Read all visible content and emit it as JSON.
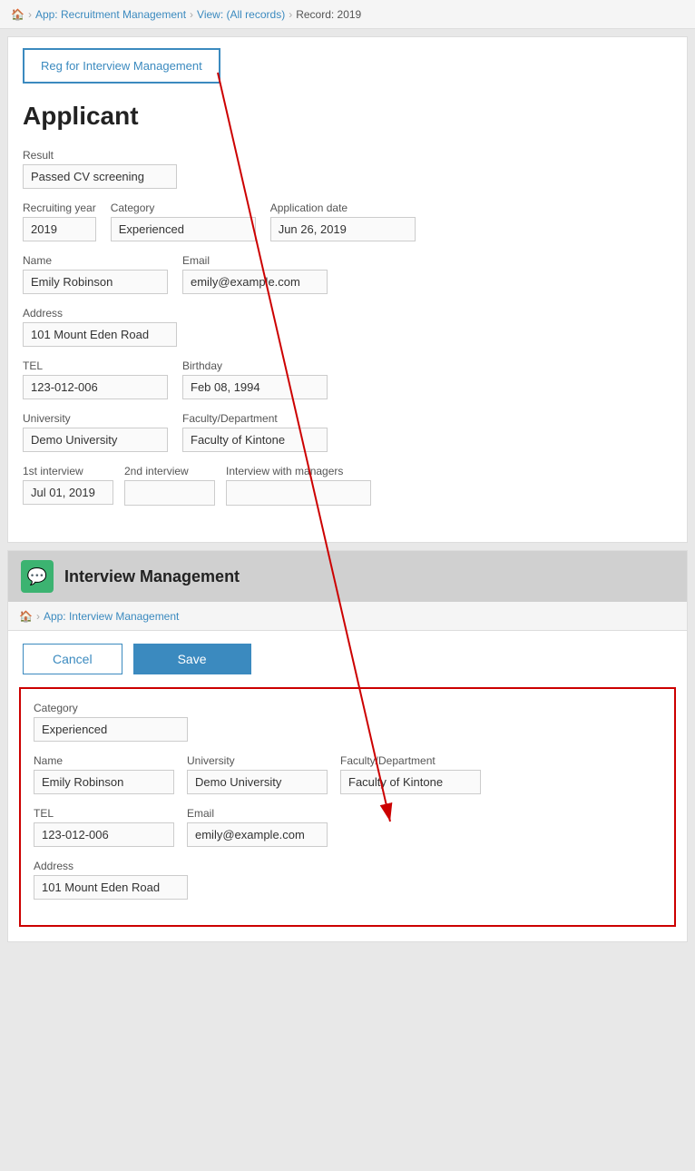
{
  "breadcrumb": {
    "home_icon": "🏠",
    "app_label": "App: Recruitment Management",
    "view_label": "View: (All records)",
    "record_label": "Record: 2019"
  },
  "top_button": {
    "label": "Reg for Interview Management"
  },
  "applicant": {
    "title": "Applicant",
    "fields": {
      "result_label": "Result",
      "result_value": "Passed CV screening",
      "recruiting_year_label": "Recruiting year",
      "recruiting_year_value": "2019",
      "category_label": "Category",
      "category_value": "Experienced",
      "application_date_label": "Application date",
      "application_date_value": "Jun 26, 2019",
      "name_label": "Name",
      "name_value": "Emily Robinson",
      "email_label": "Email",
      "email_value": "emily@example.com",
      "address_label": "Address",
      "address_value": "101 Mount Eden Road",
      "tel_label": "TEL",
      "tel_value": "123-012-006",
      "birthday_label": "Birthday",
      "birthday_value": "Feb 08, 1994",
      "university_label": "University",
      "university_value": "Demo University",
      "faculty_label": "Faculty/Department",
      "faculty_value": "Faculty of Kintone",
      "interview1_label": "1st interview",
      "interview1_value": "Jul 01, 2019",
      "interview2_label": "2nd interview",
      "interview2_value": "",
      "interview_managers_label": "Interview with managers",
      "interview_managers_value": ""
    }
  },
  "interview_management": {
    "header_title": "Interview Management",
    "header_icon": "💬",
    "breadcrumb": {
      "home_icon": "🏠",
      "app_label": "App: Interview Management"
    },
    "cancel_label": "Cancel",
    "save_label": "Save",
    "form": {
      "category_label": "Category",
      "category_value": "Experienced",
      "name_label": "Name",
      "name_value": "Emily Robinson",
      "university_label": "University",
      "university_value": "Demo University",
      "faculty_label": "Faculty/Department",
      "faculty_value": "Faculty of Kintone",
      "tel_label": "TEL",
      "tel_value": "123-012-006",
      "email_label": "Email",
      "email_value": "emily@example.com",
      "address_label": "Address",
      "address_value": "101 Mount Eden Road"
    }
  }
}
